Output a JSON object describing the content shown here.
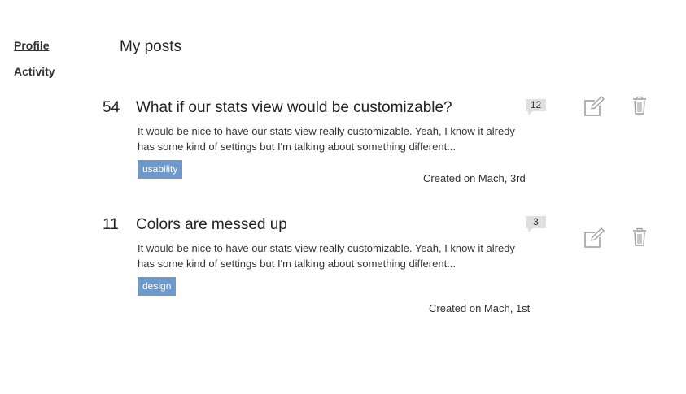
{
  "sidebar": {
    "items": [
      {
        "label": "Profile"
      },
      {
        "label": "Activity"
      }
    ]
  },
  "main": {
    "title": "My posts",
    "posts": [
      {
        "score": "54",
        "title": "What if our stats view would be customizable?",
        "excerpt": "It would be nice to have our stats view really customizable. Yeah, I know it alredy has some kind of settings but I'm talking about something different...",
        "tag": "usability",
        "created": "Created on Mach, 3rd",
        "comments": "12"
      },
      {
        "score": "11",
        "title": "Colors are messed up",
        "excerpt": "It would be nice to have our stats view really customizable. Yeah, I know it alredy has some kind of settings but I'm talking about something different...",
        "tag": "design",
        "created": "Created on Mach, 1st",
        "comments": "3"
      }
    ]
  },
  "icons": {
    "edit": "edit-icon",
    "delete": "trash-icon"
  },
  "colors": {
    "tag_background": "#6d9acb",
    "comment_badge": "#e0e0e0",
    "icon": "#9a9a9a"
  }
}
